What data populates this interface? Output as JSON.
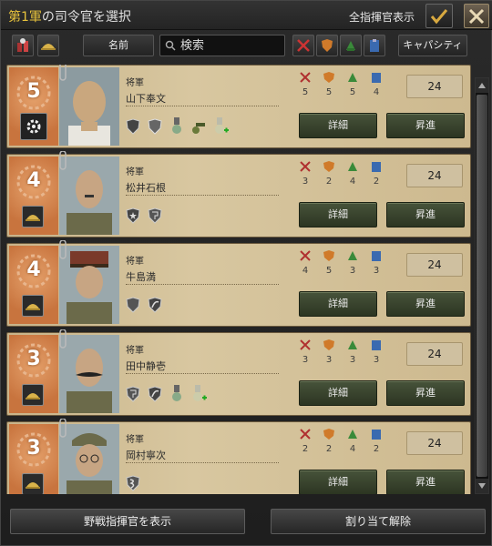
{
  "title": {
    "prefix": "第1軍",
    "suffix": "の司令官を選択"
  },
  "show_all_label": "全指揮官表示",
  "toolbar": {
    "name_sort_label": "名前",
    "search_placeholder": "検索",
    "capacity_label": "キャパシティ"
  },
  "commanders": [
    {
      "rank_num": "5",
      "rank_title": "将軍",
      "name": "山下奉文",
      "stats": {
        "attack": "5",
        "defense": "5",
        "planning": "5",
        "logistics": "4"
      },
      "capacity": "24",
      "detail_label": "詳細",
      "promote_label": "昇進",
      "traits": [
        "shield-trait-icon",
        "shield-grey-trait-icon",
        "medal-trait-icon",
        "cannon-trait-icon",
        "medal-plus-trait-icon"
      ],
      "left_trait": "gear-icon"
    },
    {
      "rank_num": "4",
      "rank_title": "将軍",
      "name": "松井石根",
      "stats": {
        "attack": "3",
        "defense": "2",
        "planning": "4",
        "logistics": "2"
      },
      "capacity": "24",
      "detail_label": "詳細",
      "promote_label": "昇進",
      "traits": [
        "star-shield-trait-icon",
        "tactics-trait-icon"
      ],
      "left_trait": "helmet-icon"
    },
    {
      "rank_num": "4",
      "rank_title": "将軍",
      "name": "牛島満",
      "stats": {
        "attack": "4",
        "defense": "5",
        "planning": "3",
        "logistics": "3"
      },
      "capacity": "24",
      "detail_label": "詳細",
      "promote_label": "昇進",
      "traits": [
        "shield-trait-icon",
        "moon-trait-icon"
      ],
      "left_trait": "helmet-icon"
    },
    {
      "rank_num": "3",
      "rank_title": "将軍",
      "name": "田中静壱",
      "stats": {
        "attack": "3",
        "defense": "3",
        "planning": "3",
        "logistics": "3"
      },
      "capacity": "24",
      "detail_label": "詳細",
      "promote_label": "昇進",
      "traits": [
        "tactics-trait-icon",
        "moon-trait-icon",
        "medal-trait-icon",
        "medal-plus-trait-icon"
      ],
      "left_trait": "helmet-icon"
    },
    {
      "rank_num": "3",
      "rank_title": "将軍",
      "name": "岡村寧次",
      "stats": {
        "attack": "2",
        "defense": "2",
        "planning": "4",
        "logistics": "2"
      },
      "capacity": "24",
      "detail_label": "詳細",
      "promote_label": "昇進",
      "traits": [
        "snake-trait-icon"
      ],
      "left_trait": "helmet-icon"
    }
  ],
  "bottom": {
    "show_field_label": "野戦指揮官を表示",
    "unassign_label": "割り当て解除"
  },
  "colors": {
    "attack": "#b03030",
    "defense": "#d07a2a",
    "planning": "#3a8a3a",
    "logistics": "#3a6ab0",
    "accent": "#e8c33c"
  }
}
